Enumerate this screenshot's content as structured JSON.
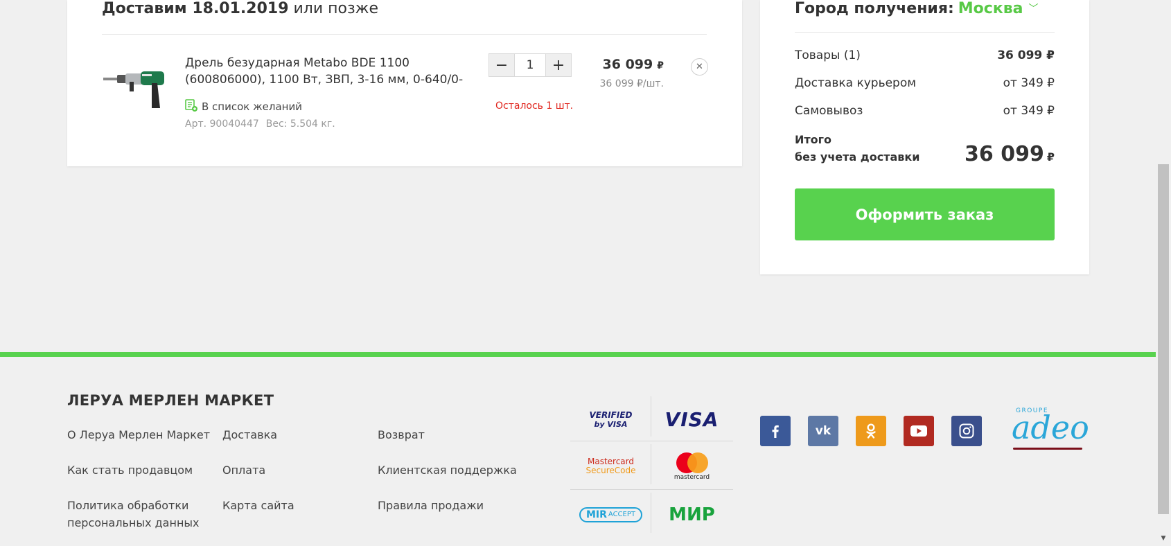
{
  "cart": {
    "delivery_bold": "Доставим 18.01.2019",
    "delivery_rest": " или позже",
    "item": {
      "name": "Дрель безударная Metabo BDE 1100 (600806000), 1100 Вт, ЗВП, 3-16 мм, 0-640/0-",
      "wishlist_label": "В список желаний",
      "article": "Арт. 90040447",
      "weight": "Вес: 5.504 кг.",
      "quantity": "1",
      "minus": "−",
      "plus": "+",
      "stock_note": "Осталось 1 шт.",
      "price": "36 099",
      "currency": "₽",
      "unit_price": "36 099  ₽/шт.",
      "remove": "✕"
    }
  },
  "summary": {
    "city_label": "Город получения:",
    "city": "Москва",
    "city_chevron": "﹀",
    "goods_label": "Товары (1)",
    "goods_value": "36 099 ₽",
    "courier_label": "Доставка курьером",
    "courier_value": "от 349 ₽",
    "pickup_label": "Самовывоз",
    "pickup_value": "от 349 ₽",
    "total_label_1": "Итого",
    "total_label_2": "без учета доставки",
    "total_value": "36 099",
    "total_currency": "₽",
    "order_button": "Оформить заказ"
  },
  "footer": {
    "brand": "ЛЕРУА МЕРЛЕН МАРКЕТ",
    "links": {
      "about": "О Леруа Мерлен Маркет",
      "delivery": "Доставка",
      "returns": "Возврат",
      "become_seller": "Как стать продавцом",
      "payment": "Оплата",
      "support": "Клиентская поддержка",
      "privacy_1": "Политика обработки",
      "privacy_2": "персональных данных",
      "sitemap": "Карта сайта",
      "sales_rules": "Правила продажи"
    },
    "payments": {
      "verified_1": "VERIFIED",
      "verified_2": "by VISA",
      "visa": "VISA",
      "mc_sc_1": "Mastercard",
      "mc_sc_2": "SecureCode",
      "mastercard": "mastercard",
      "mir_accept": "ACCEPT",
      "mir_accept_logo": "MIR",
      "mir": "МИР"
    },
    "adeo_small": "GROUPE",
    "adeo": "adeo"
  },
  "colors": {
    "accent_green": "#58d24e",
    "city_green": "#58c946",
    "warning_red": "#e0241c",
    "facebook": "#3b5998",
    "vk": "#5d78a5",
    "ok": "#ee9a1b",
    "youtube": "#b12a21",
    "instagram": "#3a4f8c"
  },
  "icons": {
    "social": [
      "facebook-icon",
      "vk-icon",
      "odnoklassniki-icon",
      "youtube-icon",
      "instagram-icon"
    ]
  }
}
